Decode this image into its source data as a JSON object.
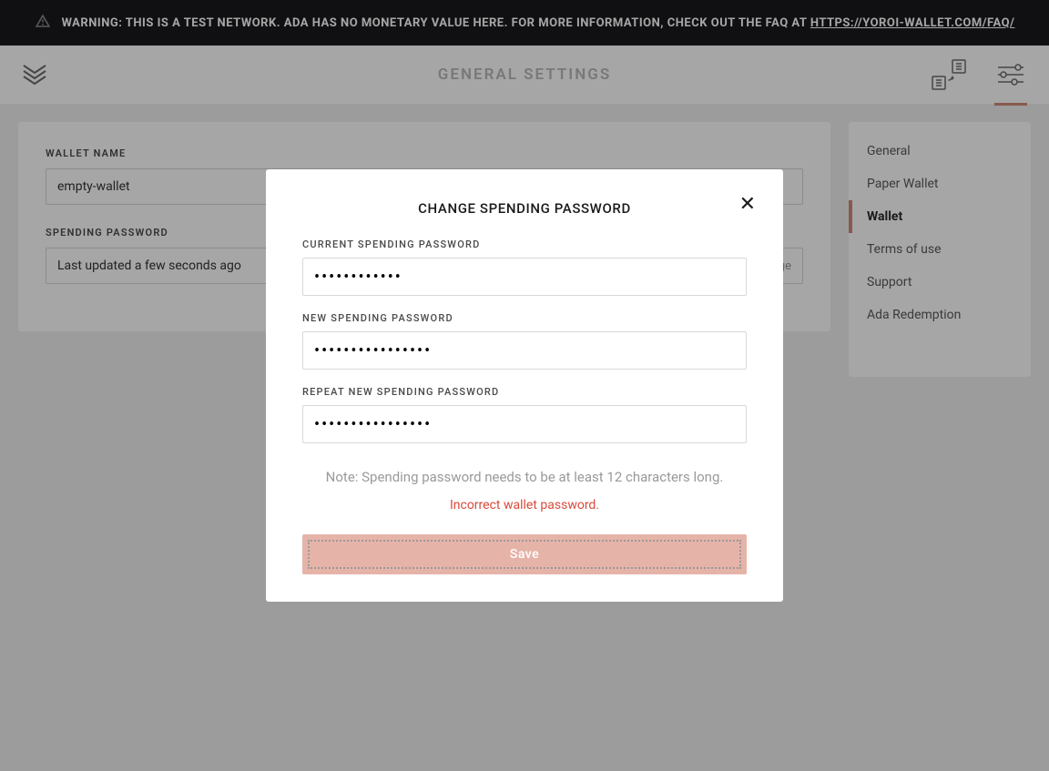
{
  "banner": {
    "text_prefix": "WARNING: THIS IS A TEST NETWORK. ADA HAS NO MONETARY VALUE HERE. FOR MORE INFORMATION, CHECK OUT THE FAQ AT ",
    "link_text": "HTTPS://YOROI-WALLET.COM/FAQ/"
  },
  "header": {
    "title": "GENERAL SETTINGS"
  },
  "content": {
    "wallet_name_label": "WALLET NAME",
    "wallet_name_value": "empty-wallet",
    "spending_password_label": "SPENDING PASSWORD",
    "spending_password_value": "Last updated a few seconds ago",
    "change_link": "change"
  },
  "sidebar": {
    "items": [
      {
        "label": "General",
        "active": false
      },
      {
        "label": "Paper Wallet",
        "active": false
      },
      {
        "label": "Wallet",
        "active": true
      },
      {
        "label": "Terms of use",
        "active": false
      },
      {
        "label": "Support",
        "active": false
      },
      {
        "label": "Ada Redemption",
        "active": false
      }
    ]
  },
  "modal": {
    "title": "CHANGE SPENDING PASSWORD",
    "current_label": "CURRENT SPENDING PASSWORD",
    "current_value": "••••••••••••",
    "new_label": "NEW SPENDING PASSWORD",
    "new_value": "••••••••••••••••",
    "repeat_label": "REPEAT NEW SPENDING PASSWORD",
    "repeat_value": "••••••••••••••••",
    "note": "Note: Spending password needs to be at least 12 characters long.",
    "error": "Incorrect wallet password.",
    "save_button": "Save"
  }
}
